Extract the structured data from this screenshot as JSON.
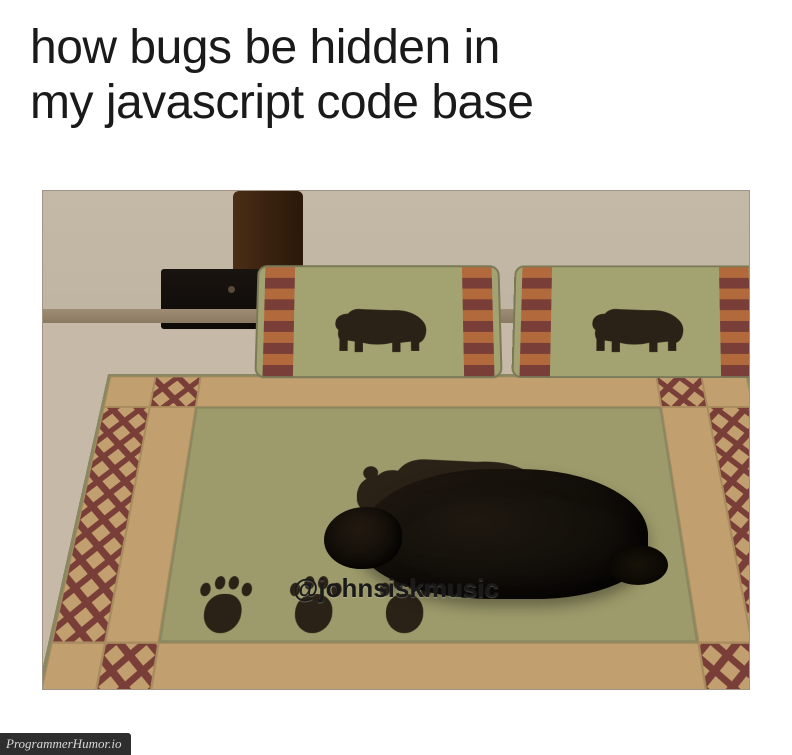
{
  "caption": {
    "line1": "how bugs be hidden in",
    "line2": "my javascript code base"
  },
  "credit_handle": "@johnsiskmusic",
  "watermark": "ProgrammerHumor.io",
  "colors": {
    "quilt_green": "#9d9b6b",
    "quilt_tan": "#c29f6e",
    "quilt_red": "#7a3e38",
    "bear_silhouette": "#2b2217",
    "dog_black": "#080604"
  },
  "scene": {
    "subject": "black dog lying on a bed camouflaged against a bear-silhouette quilt",
    "pillows": 2,
    "pawprint_count": 3
  }
}
